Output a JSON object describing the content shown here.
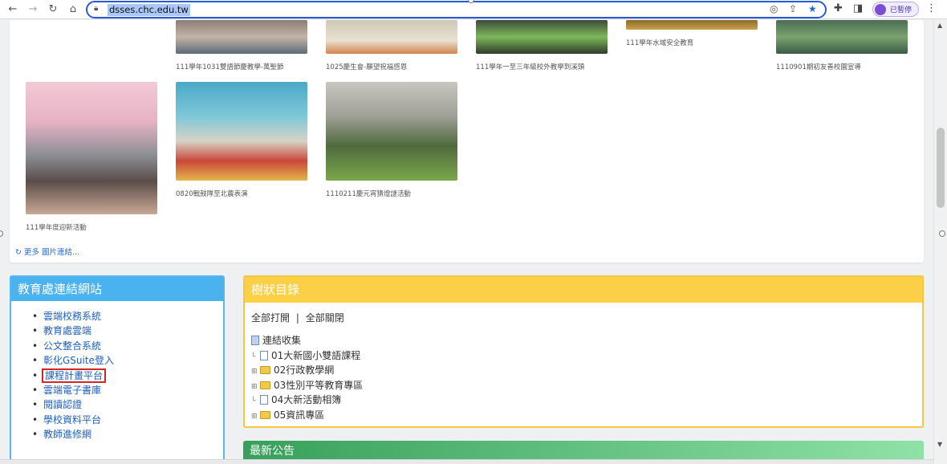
{
  "browser": {
    "url": "dsses.chc.edu.tw",
    "profile_label": "已暫停",
    "colors": {
      "accent": "#2a5bd7",
      "bookmark_star": "#1a67d2"
    }
  },
  "gallery": {
    "row1_captions": [
      "111學年1031雙語節慶教學-萬聖節",
      "1025慶生會-願望祝福感恩",
      "111學年一至三年級校外教學到溪頭",
      "111學年水域安全教育",
      "1110901期初友善校園宣導"
    ],
    "row2_captions": [
      "111學年度迎新活動",
      "0820戰鼓隊至北農表演",
      "1110211慶元宵猜燈謎活動"
    ],
    "more_link": "更多 圖片連結..."
  },
  "edu_links": {
    "title": "教育處連結網站",
    "items": [
      "雲端校務系統",
      "教育處雲端",
      "公文整合系統",
      "彰化GSuite登入",
      "課程計畫平台",
      "雲端電子書庫",
      "閱讀認證",
      "學校資料平台",
      "教師進修網"
    ],
    "highlighted_index": 4,
    "colors": {
      "header": "#4ab3ef",
      "highlight_box": "#d22727"
    }
  },
  "tree": {
    "title": "樹狀目錄",
    "expand_all": "全部打開",
    "separator": "|",
    "collapse_all": "全部關閉",
    "root": "連結收集",
    "nodes": [
      {
        "label": "01大新國小雙語課程",
        "type": "page"
      },
      {
        "label": "02行政教學網",
        "type": "folder"
      },
      {
        "label": "03性別平等教育專區",
        "type": "folder"
      },
      {
        "label": "04大新活動相簿",
        "type": "page"
      },
      {
        "label": "05資訊專區",
        "type": "folder"
      }
    ],
    "colors": {
      "header": "#fbcf46"
    }
  },
  "news": {
    "title": "最新公告"
  }
}
